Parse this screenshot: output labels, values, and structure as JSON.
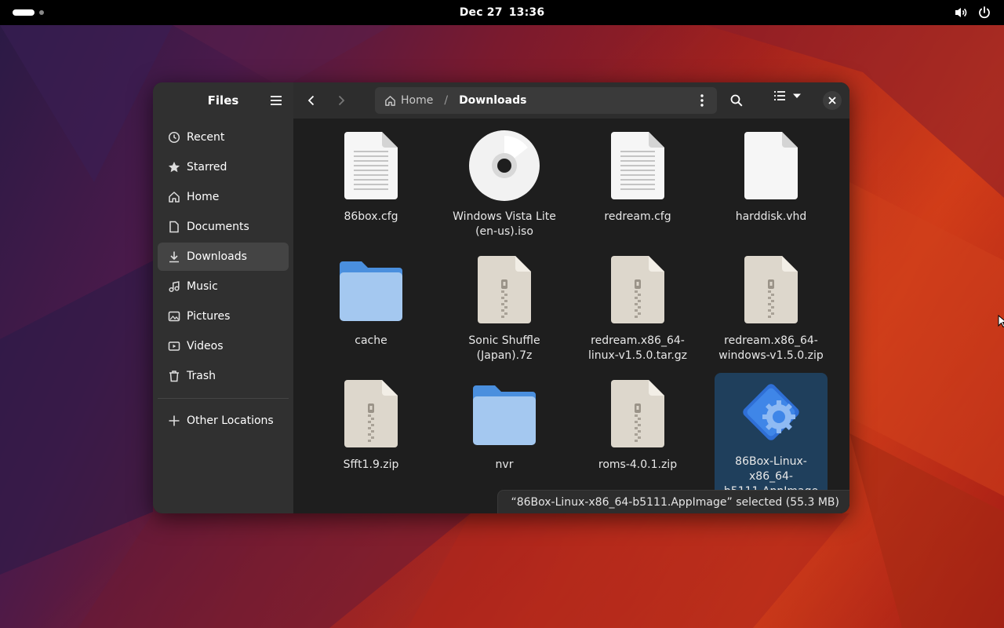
{
  "topbar": {
    "date": "Dec 27",
    "time": "13:36"
  },
  "window": {
    "sidebar": {
      "title": "Files",
      "items": [
        {
          "label": "Recent",
          "icon": "clock-icon"
        },
        {
          "label": "Starred",
          "icon": "star-icon"
        },
        {
          "label": "Home",
          "icon": "home-icon"
        },
        {
          "label": "Documents",
          "icon": "document-icon"
        },
        {
          "label": "Downloads",
          "icon": "download-icon",
          "active": true
        },
        {
          "label": "Music",
          "icon": "music-icon"
        },
        {
          "label": "Pictures",
          "icon": "picture-icon"
        },
        {
          "label": "Videos",
          "icon": "video-icon"
        },
        {
          "label": "Trash",
          "icon": "trash-icon"
        }
      ],
      "other_locations": "Other Locations"
    },
    "pathbar": {
      "home": "Home",
      "separator": "/",
      "current": "Downloads"
    },
    "files": [
      {
        "name": "86box.cfg",
        "type": "text"
      },
      {
        "name": "Windows Vista Lite (en-us).iso",
        "type": "disc"
      },
      {
        "name": "redream.cfg",
        "type": "text"
      },
      {
        "name": "harddisk.vhd",
        "type": "blank"
      },
      {
        "name": "cache",
        "type": "folder"
      },
      {
        "name": "Sonic Shuffle (Japan).7z",
        "type": "archive"
      },
      {
        "name": "redream.x86_64-linux-v1.5.0.tar.gz",
        "type": "archive"
      },
      {
        "name": "redream.x86_64-windows-v1.5.0.zip",
        "type": "archive"
      },
      {
        "name": "Sfft1.9.zip",
        "type": "archive"
      },
      {
        "name": "nvr",
        "type": "folder"
      },
      {
        "name": "roms-4.0.1.zip",
        "type": "archive"
      },
      {
        "name": "86Box-Linux-x86_64-b5111.AppImage",
        "type": "appimage",
        "selected": true
      }
    ],
    "status": "“86Box-Linux-x86_64-b5111.AppImage” selected  (55.3 MB)"
  },
  "colors": {
    "accent": "#3584e4",
    "selection": "#1f3f5c",
    "folder": "#a4c8f0"
  }
}
